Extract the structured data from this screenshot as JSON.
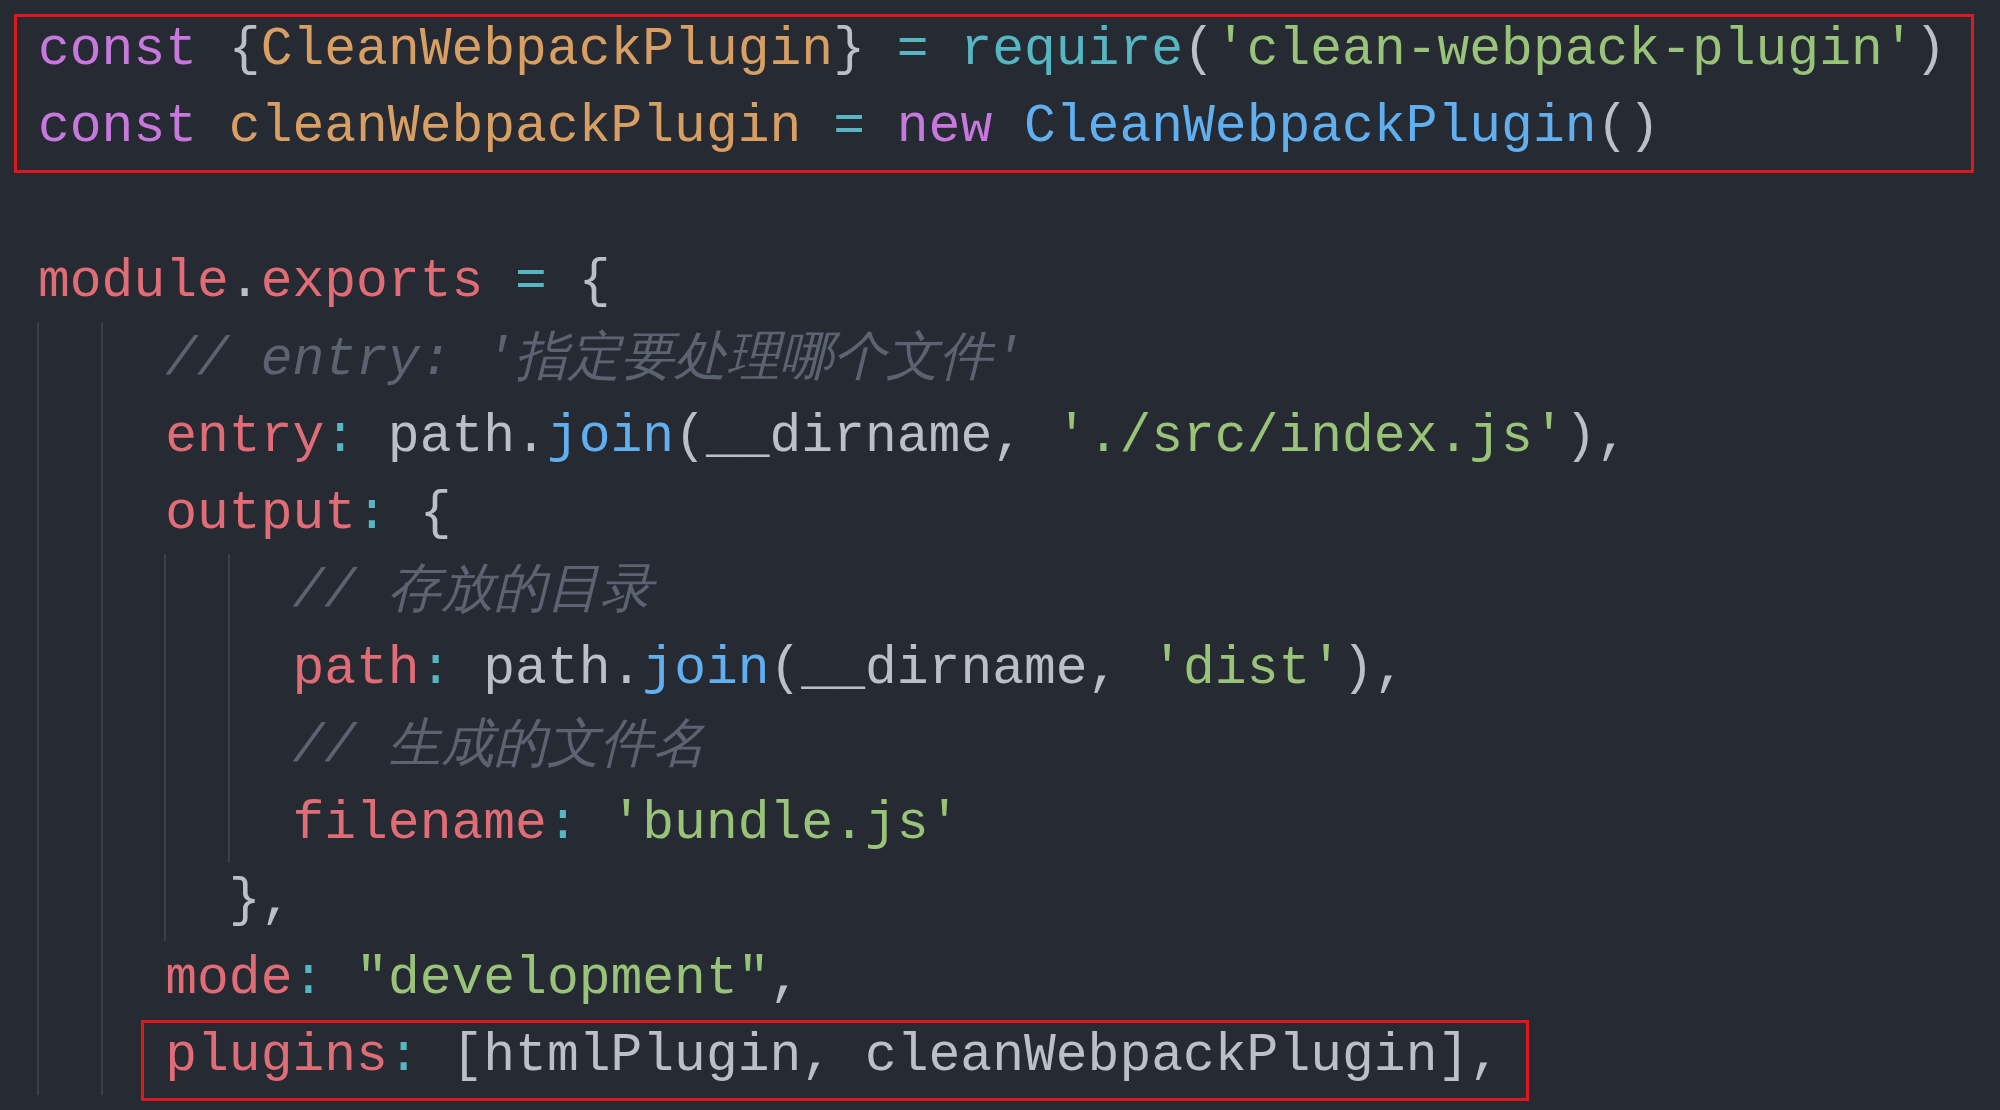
{
  "editor": {
    "blocks": [
      {
        "boxed": true,
        "lines": [
          {
            "kind": "code",
            "tokens": [
              {
                "kind": "keyword",
                "text": "const"
              },
              {
                "kind": "plain",
                "text": " {"
              },
              {
                "kind": "variable",
                "text": "CleanWebpackPlugin"
              },
              {
                "kind": "plain",
                "text": "} "
              },
              {
                "kind": "operator",
                "text": "="
              },
              {
                "kind": "builtin",
                "text": " require"
              },
              {
                "kind": "plain",
                "text": "("
              },
              {
                "kind": "string",
                "text": "'clean-webpack-plugin'"
              },
              {
                "kind": "plain",
                "text": ")"
              }
            ]
          },
          {
            "kind": "code",
            "tokens": [
              {
                "kind": "keyword",
                "text": "const"
              },
              {
                "kind": "variable",
                "text": " cleanWebpackPlugin"
              },
              {
                "kind": "operator",
                "text": " ="
              },
              {
                "kind": "keyword",
                "text": " new"
              },
              {
                "kind": "class",
                "text": " CleanWebpackPlugin"
              },
              {
                "kind": "plain",
                "text": "()"
              }
            ]
          }
        ]
      },
      {
        "boxed": false,
        "lines": [
          {
            "kind": "blank"
          },
          {
            "kind": "code",
            "tokens": [
              {
                "kind": "property",
                "text": "module"
              },
              {
                "kind": "plain",
                "text": "."
              },
              {
                "kind": "property",
                "text": "exports"
              },
              {
                "kind": "operator",
                "text": " ="
              },
              {
                "kind": "plain",
                "text": " {"
              }
            ]
          },
          {
            "kind": "code",
            "tokens": [
              {
                "kind": "comment",
                "text": "    // entry: '指定要处理哪个文件'"
              }
            ]
          },
          {
            "kind": "code",
            "tokens": [
              {
                "kind": "property",
                "text": "    entry"
              },
              {
                "kind": "operator",
                "text": ":"
              },
              {
                "kind": "plain",
                "text": " path."
              },
              {
                "kind": "method",
                "text": "join"
              },
              {
                "kind": "plain",
                "text": "(__dirname, "
              },
              {
                "kind": "string",
                "text": "'./src/index.js'"
              },
              {
                "kind": "plain",
                "text": "),"
              }
            ]
          },
          {
            "kind": "code",
            "tokens": [
              {
                "kind": "property",
                "text": "    output"
              },
              {
                "kind": "operator",
                "text": ":"
              },
              {
                "kind": "plain",
                "text": " {"
              }
            ]
          },
          {
            "kind": "code",
            "tokens": [
              {
                "kind": "comment",
                "text": "        // 存放的目录"
              }
            ]
          },
          {
            "kind": "code",
            "tokens": [
              {
                "kind": "property",
                "text": "        path"
              },
              {
                "kind": "operator",
                "text": ":"
              },
              {
                "kind": "plain",
                "text": " path."
              },
              {
                "kind": "method",
                "text": "join"
              },
              {
                "kind": "plain",
                "text": "(__dirname, "
              },
              {
                "kind": "string",
                "text": "'dist'"
              },
              {
                "kind": "plain",
                "text": "),"
              }
            ]
          },
          {
            "kind": "code",
            "tokens": [
              {
                "kind": "comment",
                "text": "        // 生成的文件名"
              }
            ]
          },
          {
            "kind": "code",
            "tokens": [
              {
                "kind": "property",
                "text": "        filename"
              },
              {
                "kind": "operator",
                "text": ":"
              },
              {
                "kind": "string",
                "text": " 'bundle.js'"
              }
            ]
          },
          {
            "kind": "code",
            "tokens": [
              {
                "kind": "plain",
                "text": "      },"
              }
            ]
          },
          {
            "kind": "code",
            "tokens": [
              {
                "kind": "property",
                "text": "    mode"
              },
              {
                "kind": "operator",
                "text": ":"
              },
              {
                "kind": "string",
                "text": " \"development\""
              },
              {
                "kind": "plain",
                "text": ","
              }
            ]
          }
        ]
      },
      {
        "boxed": true,
        "lines": [
          {
            "kind": "code",
            "tokens": [
              {
                "kind": "property",
                "text": "    plugins"
              },
              {
                "kind": "operator",
                "text": ":"
              },
              {
                "kind": "plain",
                "text": " [htmlPlugin, cleanWebpackPlugin],"
              }
            ]
          }
        ]
      }
    ]
  }
}
